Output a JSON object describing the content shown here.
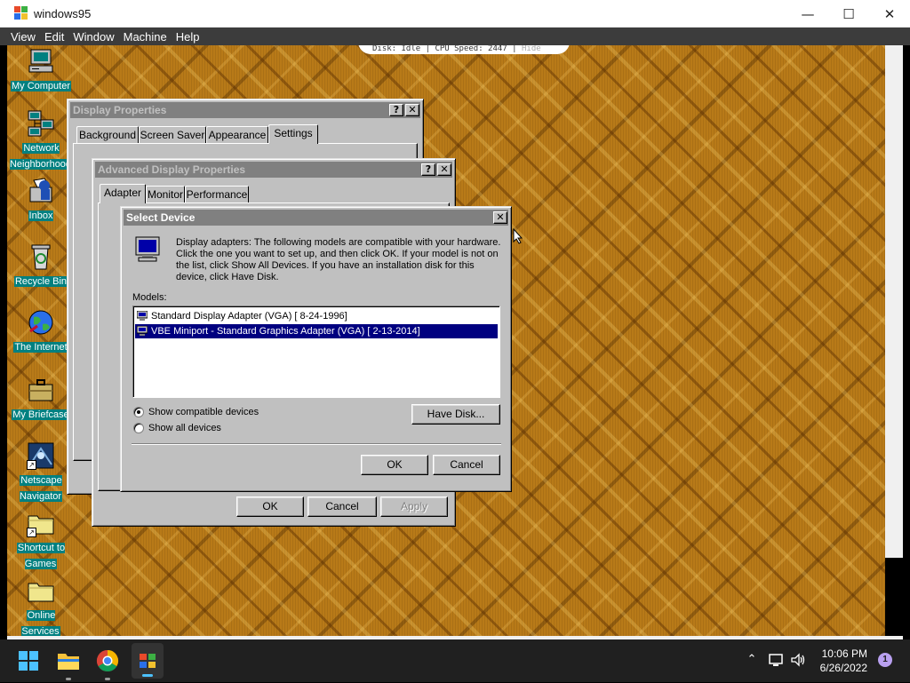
{
  "host_window": {
    "title": "windows95",
    "menu": [
      "View",
      "Edit",
      "Window",
      "Machine",
      "Help"
    ],
    "controls": {
      "minimize": "—",
      "maximize": "☐",
      "close": "✕"
    }
  },
  "status_bar": {
    "text": "Disk: Idle | CPU Speed: 2447 |",
    "hide": "Hide"
  },
  "desktop": {
    "icons": [
      {
        "label": "My Computer",
        "icon": "my-computer-icon"
      },
      {
        "label": "Network Neighborhood",
        "icon": "network-neighborhood-icon"
      },
      {
        "label": "Inbox",
        "icon": "inbox-icon"
      },
      {
        "label": "Recycle Bin",
        "icon": "recycle-bin-icon"
      },
      {
        "label": "The Internet",
        "icon": "internet-icon"
      },
      {
        "label": "My Briefcase",
        "icon": "briefcase-icon"
      },
      {
        "label": "Netscape Navigator",
        "icon": "netscape-icon"
      },
      {
        "label": "Shortcut to Games",
        "icon": "folder-shortcut-icon"
      },
      {
        "label": "Online Services",
        "icon": "folder-icon"
      }
    ]
  },
  "display_properties": {
    "title": "Display Properties",
    "tabs": [
      "Background",
      "Screen Saver",
      "Appearance",
      "Settings"
    ],
    "selected_tab": "Settings"
  },
  "advanced_display": {
    "title": "Advanced Display Properties",
    "tabs": [
      "Adapter",
      "Monitor",
      "Performance"
    ],
    "selected_tab": "Adapter",
    "buttons": {
      "ok": "OK",
      "cancel": "Cancel",
      "apply": "Apply"
    }
  },
  "select_device": {
    "title": "Select Device",
    "description": "Display adapters: The following models are compatible with your hardware. Click the one you want to set up, and then click OK. If your model is not on the list, click Show All Devices. If you have an installation disk for this device, click Have Disk.",
    "desc_lines": [
      "Display adapters: The following models are compatible with your hardware.",
      "Click the one you want to set up, and then click OK. If your model is not on",
      "the list, click Show All Devices. If you have an installation disk for this",
      "device, click Have Disk."
    ],
    "models_label": "Models:",
    "models": [
      {
        "name": "Standard Display Adapter (VGA) [ 8-24-1996]",
        "selected": false
      },
      {
        "name": "VBE Miniport - Standard Graphics Adapter (VGA) [ 2-13-2014]",
        "selected": true
      }
    ],
    "radio_compatible": "Show compatible devices",
    "radio_all": "Show all devices",
    "selected_radio": "compatible",
    "have_disk": "Have Disk...",
    "ok": "OK",
    "cancel": "Cancel"
  },
  "taskbar": {
    "time": "10:06 PM",
    "date": "6/26/2022",
    "notification_count": "1",
    "apps": [
      "start-icon",
      "file-explorer-icon",
      "chrome-icon",
      "windows95-app-icon"
    ]
  },
  "colors": {
    "title_active": "#808080",
    "selection": "#000080",
    "desktop_label_bg": "#008080",
    "taskbar": "#202020"
  }
}
